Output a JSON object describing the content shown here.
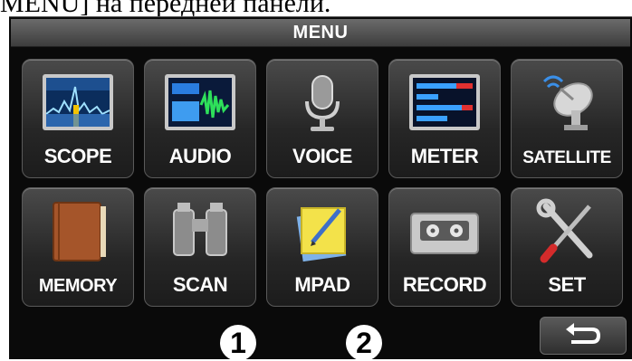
{
  "caption": "MENU] на передней панели.",
  "menu_title": "MENU",
  "tiles": {
    "scope": "SCOPE",
    "audio": "AUDIO",
    "voice": "VOICE",
    "meter": "METER",
    "satellite": "SATELLITE",
    "memory": "MEMORY",
    "scan": "SCAN",
    "mpad": "MPAD",
    "record": "RECORD",
    "set": "SET"
  },
  "callouts": [
    "1",
    "2"
  ],
  "back_icon": "return-arrow-icon"
}
